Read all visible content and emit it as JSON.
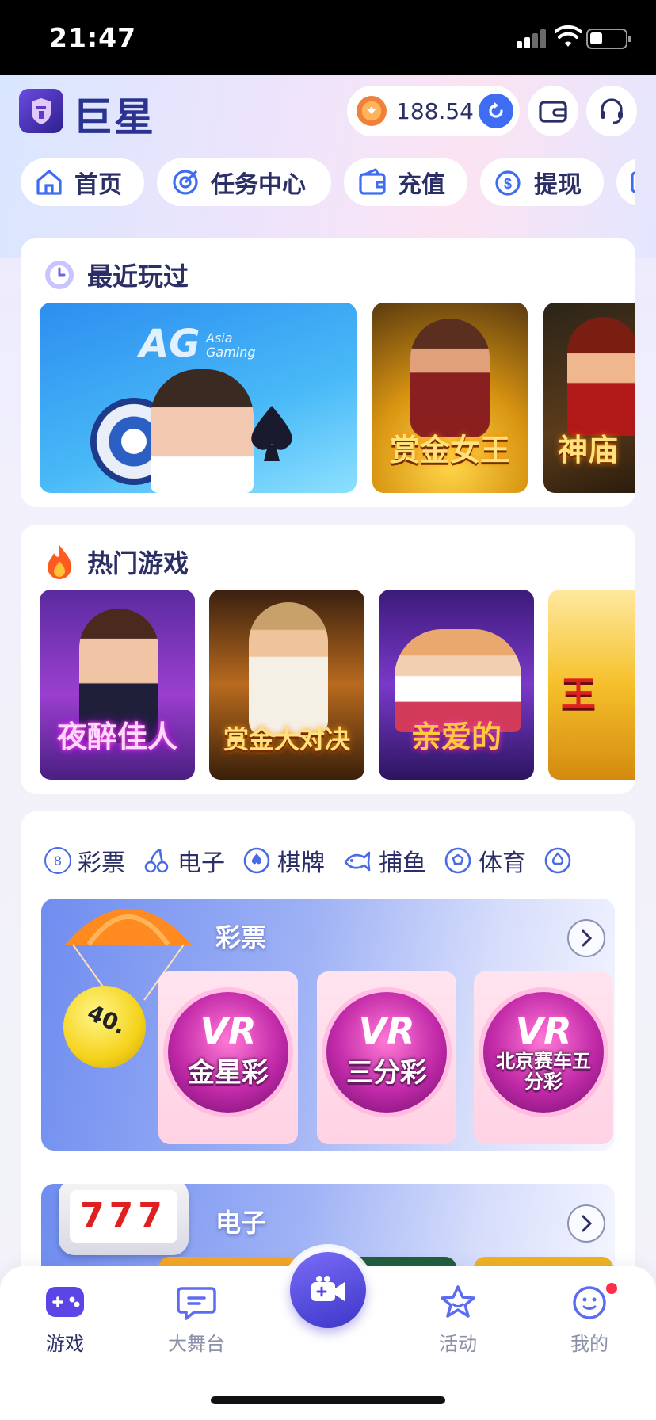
{
  "status_bar": {
    "time": "21:47"
  },
  "header": {
    "brand": "巨星",
    "balance": "188.54"
  },
  "nav_tabs": [
    {
      "label": "首页",
      "icon": "home-icon"
    },
    {
      "label": "任务中心",
      "icon": "target-icon"
    },
    {
      "label": "充值",
      "icon": "wallet-icon"
    },
    {
      "label": "提现",
      "icon": "dollar-icon"
    }
  ],
  "recent": {
    "title": "最近玩过",
    "games": [
      {
        "name": "AG Asia Gaming",
        "brand_top": "AG",
        "brand_sub": "Asia Gaming"
      },
      {
        "name": "赏金女王"
      },
      {
        "name": "神庙"
      }
    ]
  },
  "hot": {
    "title": "热门游戏",
    "games": [
      {
        "name": "夜醉佳人"
      },
      {
        "name": "赏金大对决"
      },
      {
        "name": "亲爱的"
      },
      {
        "name": "王"
      }
    ]
  },
  "categories": {
    "tabs": [
      {
        "label": "彩票",
        "icon": "lottery-ball-icon",
        "glyph": "8"
      },
      {
        "label": "电子",
        "icon": "cherry-icon",
        "glyph": ""
      },
      {
        "label": "棋牌",
        "icon": "spade-icon",
        "glyph": ""
      },
      {
        "label": "捕鱼",
        "icon": "fish-icon",
        "glyph": ""
      },
      {
        "label": "体育",
        "icon": "soccer-ball-icon",
        "glyph": ""
      }
    ],
    "lottery": {
      "title": "彩票",
      "ball_number": "40.",
      "games": [
        {
          "logo": "VR",
          "name": "金星彩"
        },
        {
          "logo": "VR",
          "name": "三分彩"
        },
        {
          "logo": "VR",
          "name": "北京赛车五分彩"
        }
      ]
    },
    "electronic": {
      "title": "电子",
      "slot_digits": "777"
    }
  },
  "bottom_nav": [
    {
      "label": "游戏",
      "icon": "gamepad-icon",
      "active": true
    },
    {
      "label": "大舞台",
      "icon": "chat-bubble-icon",
      "active": false
    },
    {
      "label": "活动",
      "icon": "star-icon",
      "active": false
    },
    {
      "label": "我的",
      "icon": "smiley-icon",
      "active": false
    }
  ],
  "colors": {
    "primary": "#3e6cf2",
    "text": "#2c2f66",
    "muted": "#8b8fa8",
    "badge": "#ff2d4b"
  }
}
